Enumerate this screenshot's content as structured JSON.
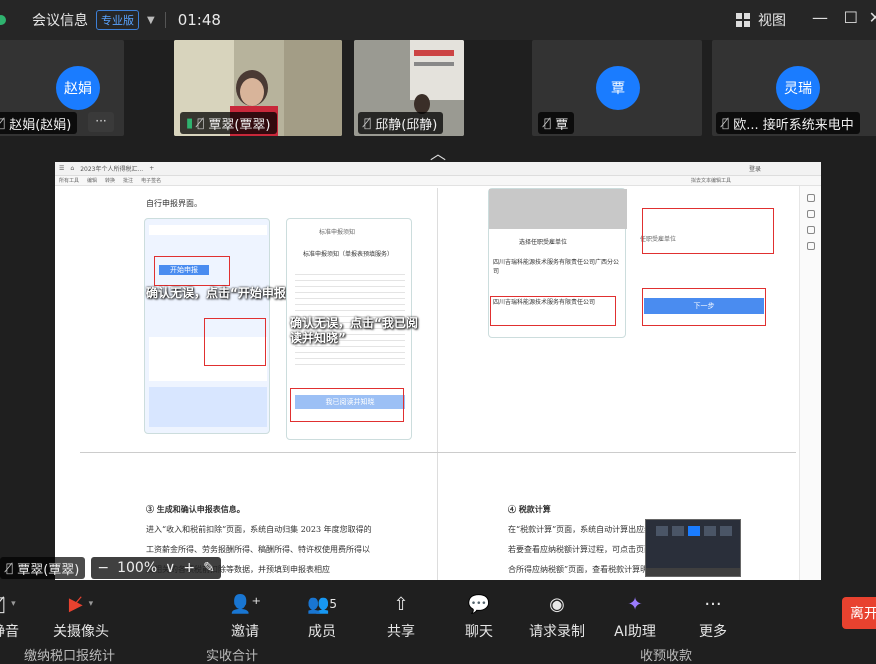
{
  "titlebar": {
    "app_title": "会议信息",
    "edition": "专业版",
    "timer": "01:48",
    "view_label": "视图"
  },
  "participants": [
    {
      "name": "赵娟(赵娟)",
      "avatar_text": "赵娟",
      "more": "···"
    },
    {
      "name": "覃翠(覃翠)",
      "avatar_text": "",
      "more": ""
    },
    {
      "name": "邱静(邱静)",
      "avatar_text": "",
      "more": ""
    },
    {
      "name": "覃",
      "avatar_text": "覃",
      "more": ""
    },
    {
      "name": "欧... 接听系统来电中",
      "avatar_text": "灵瑞",
      "more": ""
    }
  ],
  "shared": {
    "tab_title": "2023年个人所得税汇...",
    "toolbar_items": [
      "所有工具",
      "编辑",
      "转换",
      "批注",
      "电子签名"
    ],
    "right_label": "拟去文本编辑工具",
    "login": "登录",
    "left_top_text": "自行申报界面。",
    "overlay_1": "确认无误，点击“开始申报”",
    "overlay_2": "确认无误，点击“我已阅读并知晓”",
    "notice_title": "标准申报须知",
    "notice_sub": "标准申报须知（单报表预填服务）",
    "right_title": "选择任职受雇单位",
    "company": "四川吉瑞科能源技术服务有限责任公司广西分公司",
    "company2": "四川吉瑞科能源技术服务有限责任公司",
    "next_btn": "下一步",
    "start_btn": "开始申报",
    "read_btn": "我已阅读并知晓",
    "bottom_left_heading": "③  生成和确认申报表信息。",
    "bottom_left_p1": "进入“收入和税前扣除”页面，系统自动归集 2023 年度您取得的",
    "bottom_left_p2": "工资薪金所得、劳务报酬所得、稿酬所得、特许权使用费所得以",
    "bottom_left_p3": "及相关的各项税前扣除等数据，并预填到申报表相应",
    "bottom_right_heading": "④  税款计算",
    "bottom_right_p1": "在“税款计算”页面，系统自动计算出应纳税额，已缴税额，",
    "bottom_right_p2": "若要查看应纳税额计算过程，可点击页面上的税额栏进入“综",
    "bottom_right_p3": "合所得应纳税额”页面，查看税款计算明细，存在多缴税款，"
  },
  "zoom": {
    "presenter": "覃翠(覃翠)",
    "level": "100%"
  },
  "toolbar": [
    {
      "label": "静音",
      "icon": "mic-icon"
    },
    {
      "label": "关摄像头",
      "icon": "camera-off-icon"
    },
    {
      "label": "邀请",
      "icon": "invite-icon"
    },
    {
      "label": "成员",
      "icon": "members-icon",
      "count": "5"
    },
    {
      "label": "共享",
      "icon": "share-icon"
    },
    {
      "label": "聊天",
      "icon": "chat-icon"
    },
    {
      "label": "请求录制",
      "icon": "record-icon"
    },
    {
      "label": "AI助理",
      "icon": "ai-icon"
    },
    {
      "label": "更多",
      "icon": "more-icon"
    }
  ],
  "leave_label": "离开",
  "below_text": {
    "left": "缴纳税口报统计",
    "mid": "实收合计",
    "right": "收预收款"
  },
  "colors": {
    "accent": "#1a7cff",
    "leave": "#e8422f",
    "red_box": "#e03030"
  }
}
